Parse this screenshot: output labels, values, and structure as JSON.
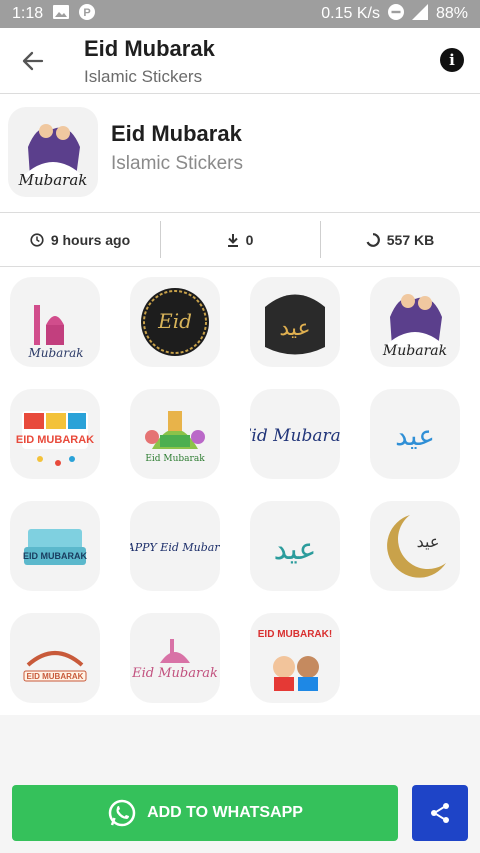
{
  "status_bar": {
    "time": "1:18",
    "net_speed": "0.15 K/s",
    "battery": "88%"
  },
  "header": {
    "title": "Eid Mubarak",
    "subtitle": "Islamic Stickers"
  },
  "pack": {
    "name": "Eid Mubarak",
    "publisher": "Islamic Stickers"
  },
  "stats": {
    "updated": "9 hours ago",
    "downloads": "0",
    "size": "557 KB"
  },
  "footer": {
    "add_label": "ADD TO WHATSAPP"
  },
  "stickers": [
    {
      "text": "Mubarak"
    },
    {
      "text": "Eid"
    },
    {
      "text": "عيد"
    },
    {
      "text": "Mubarak"
    },
    {
      "text": "EID MUBARAK"
    },
    {
      "text": "Eid Mubarak"
    },
    {
      "text": "Eid Mubarak"
    },
    {
      "text": "عيد"
    },
    {
      "text": "EID MUBARAK"
    },
    {
      "text": "HAPPY Eid Mubarak"
    },
    {
      "text": "عيد"
    },
    {
      "text": "عيد"
    },
    {
      "text": "EID MUBARAK"
    },
    {
      "text": "Eid Mubarak"
    },
    {
      "text": "EID MUBARAK!"
    }
  ]
}
